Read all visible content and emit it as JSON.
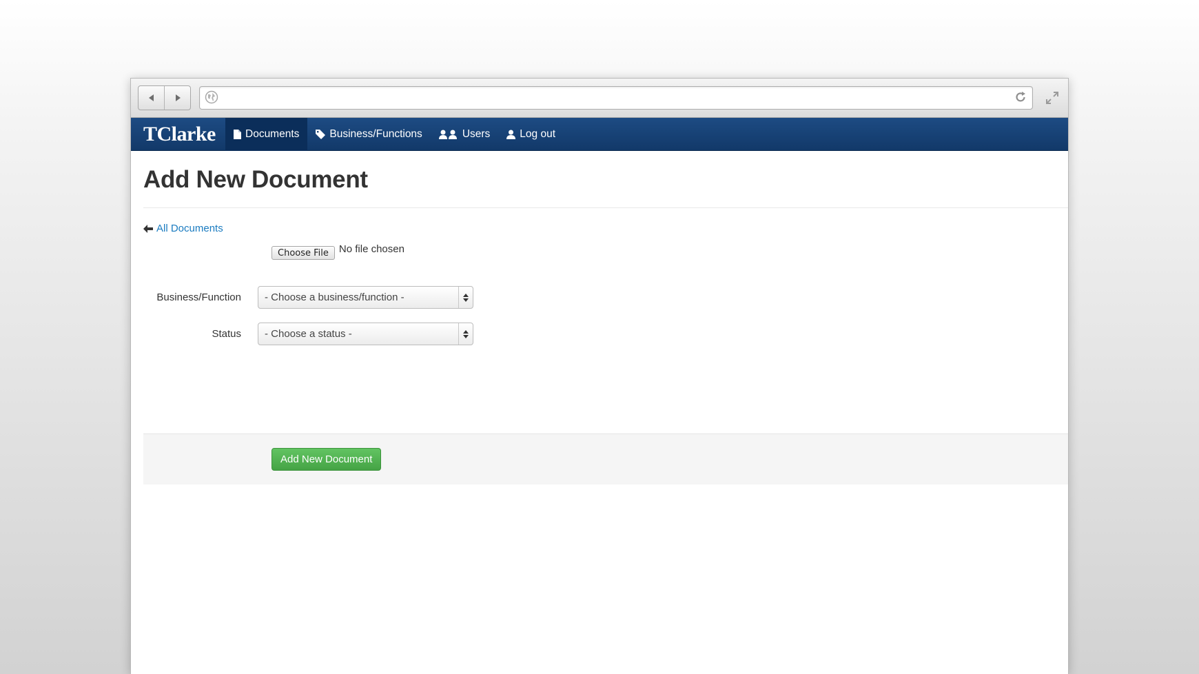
{
  "browser": {
    "back_icon": "back-arrow-icon",
    "forward_icon": "forward-arrow-icon",
    "address_value": "",
    "site_icon": "globe-icon",
    "reload_icon": "reload-icon",
    "expand_icon": "expand-icon"
  },
  "navbar": {
    "brand": "TClarke",
    "items": [
      {
        "label": "Documents",
        "icon": "document-icon",
        "active": true
      },
      {
        "label": "Business/Functions",
        "icon": "tag-icon",
        "active": false
      },
      {
        "label": "Users",
        "icon": "users-icon",
        "active": false
      },
      {
        "label": "Log out",
        "icon": "user-icon",
        "active": false
      }
    ]
  },
  "page": {
    "title": "Add New Document",
    "back_link": "All Documents",
    "file": {
      "button_label": "Choose File",
      "status": "No file chosen"
    },
    "fields": [
      {
        "label": "Business/Function",
        "selected": "- Choose a business/function -"
      },
      {
        "label": "Status",
        "selected": "- Choose a status -"
      }
    ],
    "submit_label": "Add New Document"
  },
  "colors": {
    "navbar": "#1d4b83",
    "navbar_active": "#0b2e5a",
    "link": "#1a7bc0",
    "success": "#51b451"
  }
}
